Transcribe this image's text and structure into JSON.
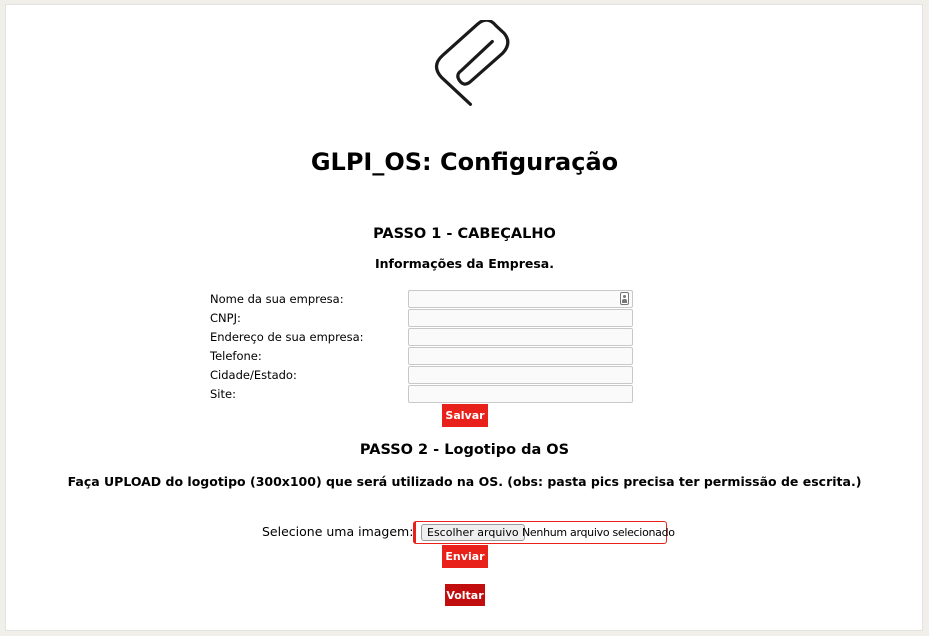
{
  "page": {
    "title": "GLPI_OS: Configuração",
    "logo_icon": "paperclip-icon"
  },
  "step1": {
    "heading": "PASSO 1 - CABEÇALHO",
    "subtitle": "Informações da Empresa.",
    "fields": [
      {
        "label": "Nome da sua empresa:",
        "value": ""
      },
      {
        "label": "CNPJ:",
        "value": ""
      },
      {
        "label": "Endereço de sua empresa:",
        "value": ""
      },
      {
        "label": "Telefone:",
        "value": ""
      },
      {
        "label": "Cidade/Estado:",
        "value": ""
      },
      {
        "label": "Site:",
        "value": ""
      }
    ],
    "save_label": "Salvar"
  },
  "step2": {
    "heading": "PASSO 2 - Logotipo da OS",
    "note": "Faça UPLOAD do logotipo (300x100) que será utilizado na OS. (obs: pasta pics precisa ter permissão de escrita.)",
    "file_label": "Selecione uma imagem:",
    "file_button": "Escolher arquivo",
    "file_status": "Nenhum arquivo selecionado",
    "send_label": "Enviar"
  },
  "back_label": "Voltar",
  "colors": {
    "button": "#e8221b",
    "button_dark": "#c10d0d",
    "background": "#f0efea"
  }
}
